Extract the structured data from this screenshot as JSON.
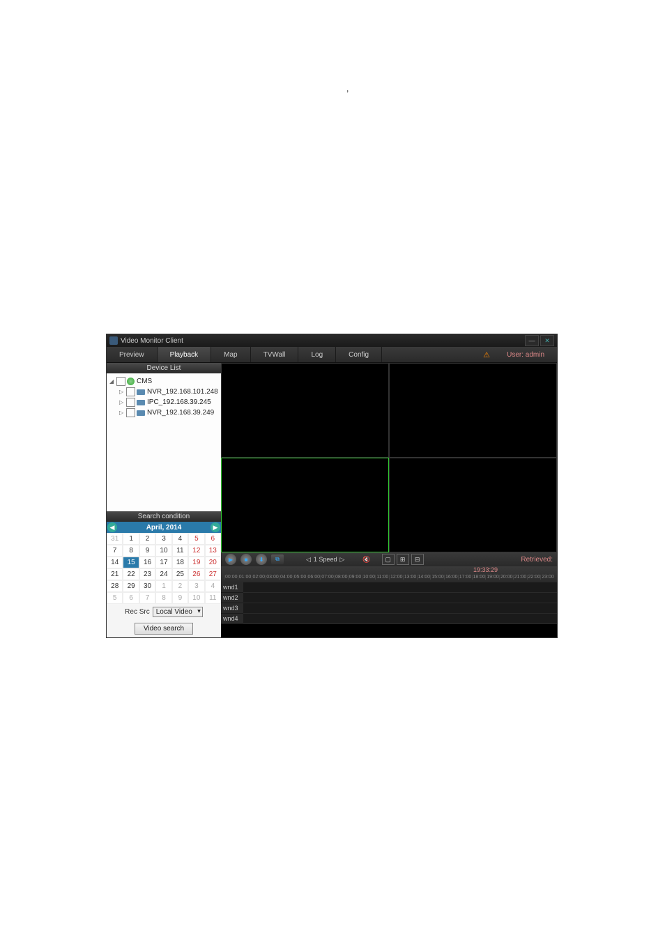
{
  "apostrophe": ",",
  "window": {
    "title": "Video Monitor Client",
    "user_label": "User: admin"
  },
  "tabs": {
    "preview": "Preview",
    "playback": "Playback",
    "map": "Map",
    "tvwall": "TVWall",
    "log": "Log",
    "config": "Config"
  },
  "device_list": {
    "header": "Device List",
    "root": "CMS",
    "items": [
      "NVR_192.168.101.248",
      "IPC_192.168.39.245",
      "NVR_192.168.39.249"
    ]
  },
  "search_header": "Search condition",
  "calendar": {
    "title": "April, 2014",
    "rows": [
      [
        "31",
        "1",
        "2",
        "3",
        "4",
        "5",
        "6"
      ],
      [
        "7",
        "8",
        "9",
        "10",
        "11",
        "12",
        "13"
      ],
      [
        "14",
        "15",
        "16",
        "17",
        "18",
        "19",
        "20"
      ],
      [
        "21",
        "22",
        "23",
        "24",
        "25",
        "26",
        "27"
      ],
      [
        "28",
        "29",
        "30",
        "1",
        "2",
        "3",
        "4"
      ],
      [
        "5",
        "6",
        "7",
        "8",
        "9",
        "10",
        "11"
      ]
    ],
    "selected": "15"
  },
  "rec_src_label": "Rec Src",
  "rec_src_value": "Local Video",
  "search_btn": "Video search",
  "speed": "1 Speed",
  "retrieved": "Retrieved:",
  "time_indicator": "19:33:29",
  "hours": [
    "00:00",
    "01:00",
    "02:00",
    "03:00",
    "04:00",
    "05:00",
    "06:00",
    "07:00",
    "08:00",
    "09:00",
    "10:00",
    "11:00",
    "12:00",
    "13:00",
    "14:00",
    "15:00",
    "16:00",
    "17:00",
    "18:00",
    "19:00",
    "20:00",
    "21:00",
    "22:00",
    "23:00"
  ],
  "wnds": [
    "wnd1",
    "wnd2",
    "wnd3",
    "wnd4"
  ]
}
